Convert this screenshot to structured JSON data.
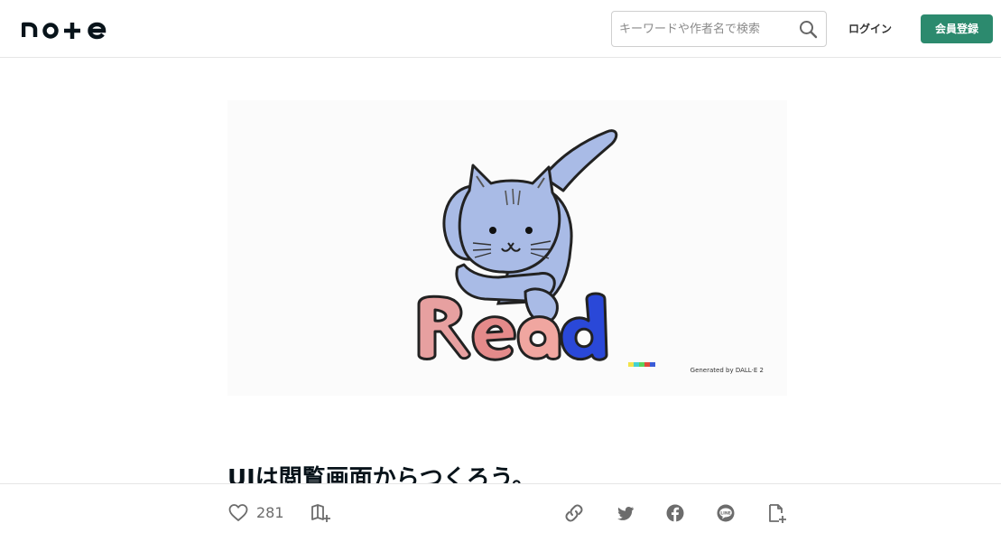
{
  "header": {
    "logo_text": "note",
    "search": {
      "placeholder": "キーワードや作者名で検索",
      "value": ""
    },
    "login_label": "ログイン",
    "signup_label": "会員登録"
  },
  "article": {
    "hero_image": {
      "caption": "Generated by DALL·E 2",
      "drawn_text": "Read"
    },
    "title": "UIは閲覧画面からつくろう。"
  },
  "footer_bar": {
    "like_count": "281",
    "icons": [
      "heart-icon",
      "magazine-add-icon",
      "link-icon",
      "twitter-icon",
      "facebook-icon",
      "line-icon",
      "note-embed-icon"
    ]
  },
  "colors": {
    "brand_green": "#2c8a6e",
    "text": "#08131a",
    "cat_blue": "#a9bbe6"
  }
}
